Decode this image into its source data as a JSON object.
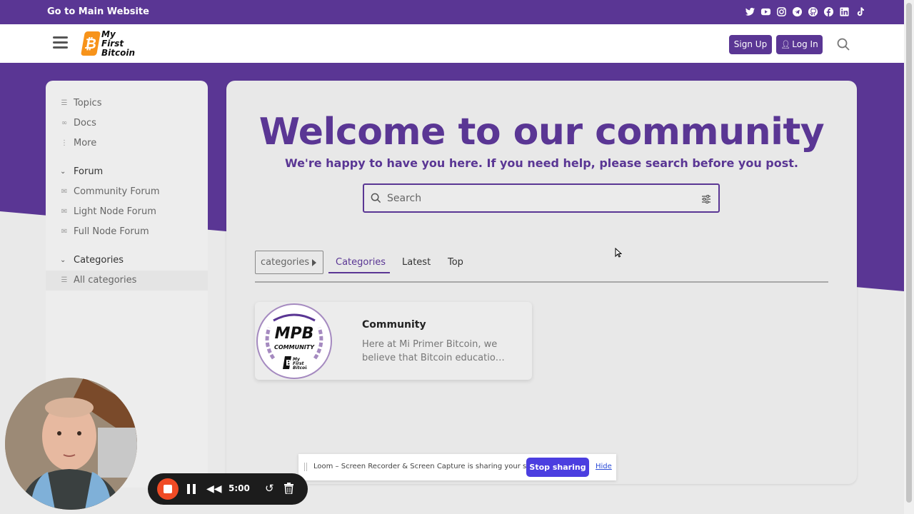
{
  "topbar": {
    "link": "Go to Main Website",
    "social_icons": [
      "twitter-icon",
      "youtube-icon",
      "instagram-icon",
      "telegram-icon",
      "github-icon",
      "facebook-icon",
      "linkedin-icon",
      "tiktok-icon"
    ]
  },
  "header": {
    "logo_text_1": "My",
    "logo_text_2": "First",
    "logo_text_3": "Bitcoin",
    "signup": "Sign Up",
    "login": "Log In"
  },
  "sidebar": {
    "items": [
      {
        "label": "Topics",
        "icon": "layers-icon"
      },
      {
        "label": "Docs",
        "icon": "link-icon"
      },
      {
        "label": "More",
        "icon": "dots-vertical-icon"
      }
    ],
    "forum_heading": "Forum",
    "forum_items": [
      {
        "label": "Community Forum",
        "icon": "envelope-icon"
      },
      {
        "label": "Light Node Forum",
        "icon": "envelope-icon"
      },
      {
        "label": "Full Node Forum",
        "icon": "envelope-icon"
      }
    ],
    "categories_heading": "Categories",
    "categories_items": [
      {
        "label": "All categories",
        "icon": "list-icon"
      }
    ]
  },
  "main": {
    "title": "Welcome to our community",
    "subtitle": "We're happy to have you here. If you need help, please search before you post.",
    "search_placeholder": "Search",
    "nav_dropdown": "categories",
    "tabs": [
      "Categories",
      "Latest",
      "Top"
    ],
    "active_tab": "Categories",
    "category": {
      "logo_title": "MPB",
      "logo_sub": "COMMUNITY",
      "name": "Community",
      "description": "Here at Mi Primer Bitcoin, we believe that Bitcoin educatio…"
    }
  },
  "loom": {
    "message": "Loom – Screen Recorder & Screen Capture is sharing your screen.",
    "stop": "Stop sharing",
    "hide": "Hide"
  },
  "recorder": {
    "time": "5:00"
  },
  "colors": {
    "brand_purple": "#5a3694",
    "bitcoin_orange": "#f7931a",
    "loom_blue": "#4b3ee0",
    "record_red": "#f04b25"
  }
}
